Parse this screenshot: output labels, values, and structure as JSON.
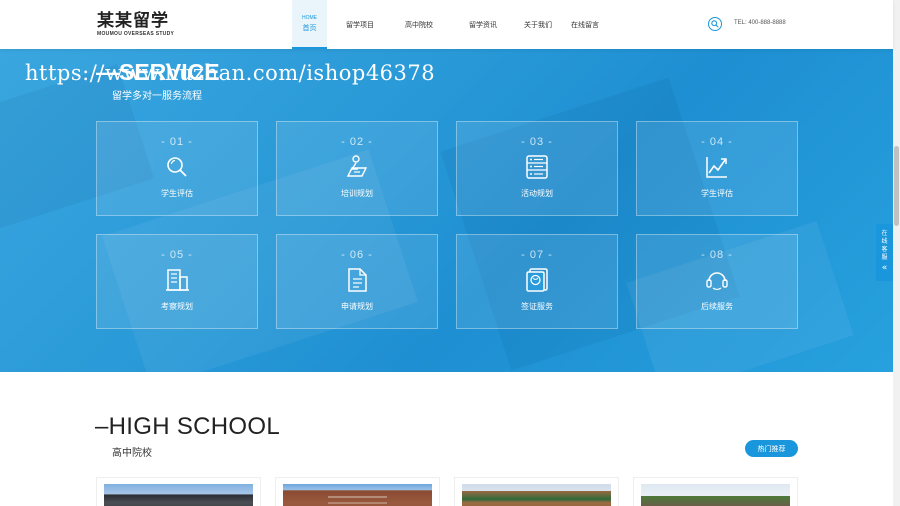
{
  "header": {
    "logo_cn": "某某留学",
    "logo_en": "MOUMOU OVERSEAS STUDY",
    "nav": [
      {
        "en": "HOME",
        "label": "首页",
        "active": true
      },
      {
        "label": "留学项目"
      },
      {
        "label": "高中院校"
      },
      {
        "label": "留学资讯"
      },
      {
        "label": "关于我们"
      },
      {
        "label": "在线留言"
      }
    ],
    "tel": "TEL: 400-888-8888",
    "accent": "#1a97dc"
  },
  "service": {
    "watermark": "https://www.huzhan.com/ishop46378",
    "title": "—SERVICE",
    "subtitle": "留学多对一服务流程",
    "items": [
      {
        "num": "- 01 -",
        "label": "学生评估",
        "icon": "search-icon"
      },
      {
        "num": "- 02 -",
        "label": "培训规划",
        "icon": "study-icon"
      },
      {
        "num": "- 03 -",
        "label": "活动规划",
        "icon": "list-icon"
      },
      {
        "num": "- 04 -",
        "label": "学生评估",
        "icon": "chart-icon"
      },
      {
        "num": "- 05 -",
        "label": "考察规划",
        "icon": "building-icon"
      },
      {
        "num": "- 06 -",
        "label": "申请规划",
        "icon": "document-icon"
      },
      {
        "num": "- 07 -",
        "label": "签证服务",
        "icon": "passport-icon"
      },
      {
        "num": "- 08 -",
        "label": "后续服务",
        "icon": "support-icon"
      }
    ]
  },
  "kefu": {
    "line1": "在",
    "line2": "线",
    "line3": "客",
    "line4": "服",
    "arrow": "«"
  },
  "highschool": {
    "title": "–HIGH SCHOOL",
    "subtitle": "高中院校",
    "hot_button": "热门推荐"
  }
}
